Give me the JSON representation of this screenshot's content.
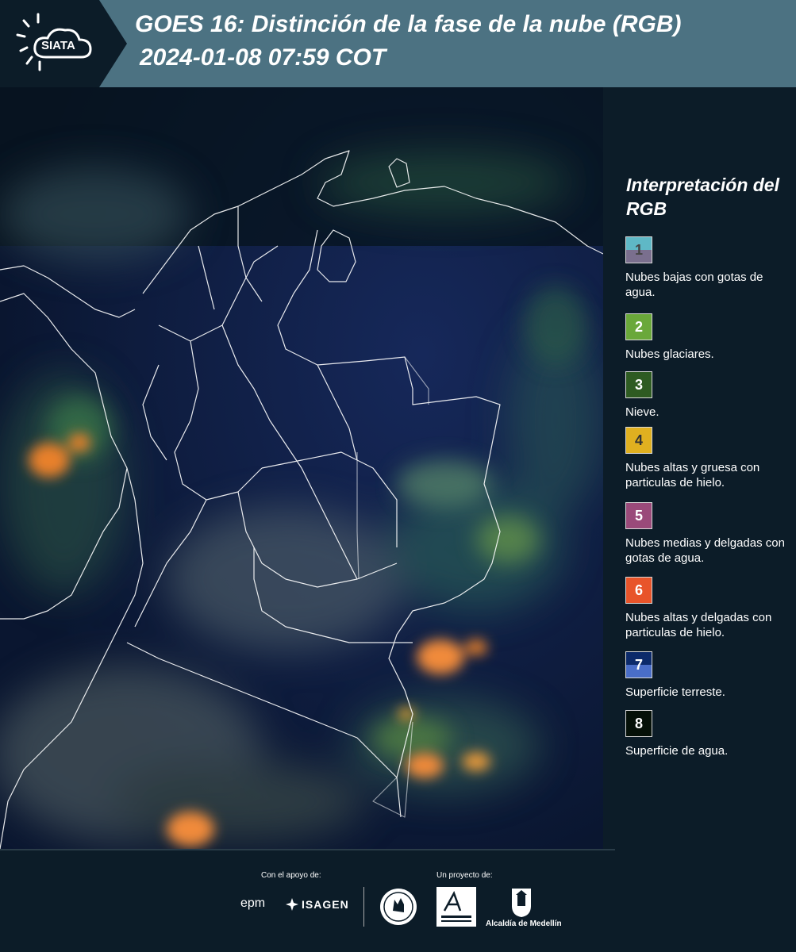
{
  "header": {
    "logo_text": "SIATA",
    "title_line1": "GOES 16: Distinción de la fase de la nube (RGB)",
    "title_line2": "2024-01-08 07:59 COT"
  },
  "legend": {
    "title": "Interpretación del RGB",
    "items": [
      {
        "number": "1",
        "label": "Nubes bajas con gotas de agua.",
        "color_top": "#5fb8c6",
        "color_bottom": "#7a6f8e",
        "number_color": "#444444"
      },
      {
        "number": "2",
        "label": "Nubes glaciares.",
        "color_top": "#6aa83a",
        "color_bottom": "#6aa83a",
        "number_color": "#ffffff"
      },
      {
        "number": "3",
        "label": "Nieve.",
        "color_top": "#2e5b22",
        "color_bottom": "#2e5b22",
        "number_color": "#ffffff"
      },
      {
        "number": "4",
        "label": "Nubes altas y gruesa con particulas de hielo.",
        "color_top": "#e0b020",
        "color_bottom": "#e0b020",
        "number_color": "#333333"
      },
      {
        "number": "5",
        "label": "Nubes medias y delgadas con gotas de agua.",
        "color_top": "#9a4a7a",
        "color_bottom": "#9a4a7a",
        "number_color": "#ffffff"
      },
      {
        "number": "6",
        "label": "Nubes altas y delgadas con particulas de hielo.",
        "color_top": "#e8542a",
        "color_bottom": "#e8542a",
        "number_color": "#ffffff"
      },
      {
        "number": "7",
        "label": "Superficie terreste.",
        "color_top": "#0c2a6a",
        "color_bottom": "#4a6ec8",
        "number_color": "#ffffff"
      },
      {
        "number": "8",
        "label": "Superficie de agua.",
        "color_top": "#051008",
        "color_bottom": "#051008",
        "number_color": "#ffffff"
      }
    ]
  },
  "footer": {
    "support_label": "Con el apoyo de:",
    "project_label": "Un proyecto de:",
    "epm_logo": "epm",
    "isagen_logo": "ISAGEN",
    "area_logo": "Área Metropolitana",
    "alcaldia_label": "Alcaldía de Medellín"
  },
  "colors": {
    "header_bg": "#4c7282",
    "panel_bg": "#0c1c28",
    "map_bg": "#0a1a2e"
  }
}
